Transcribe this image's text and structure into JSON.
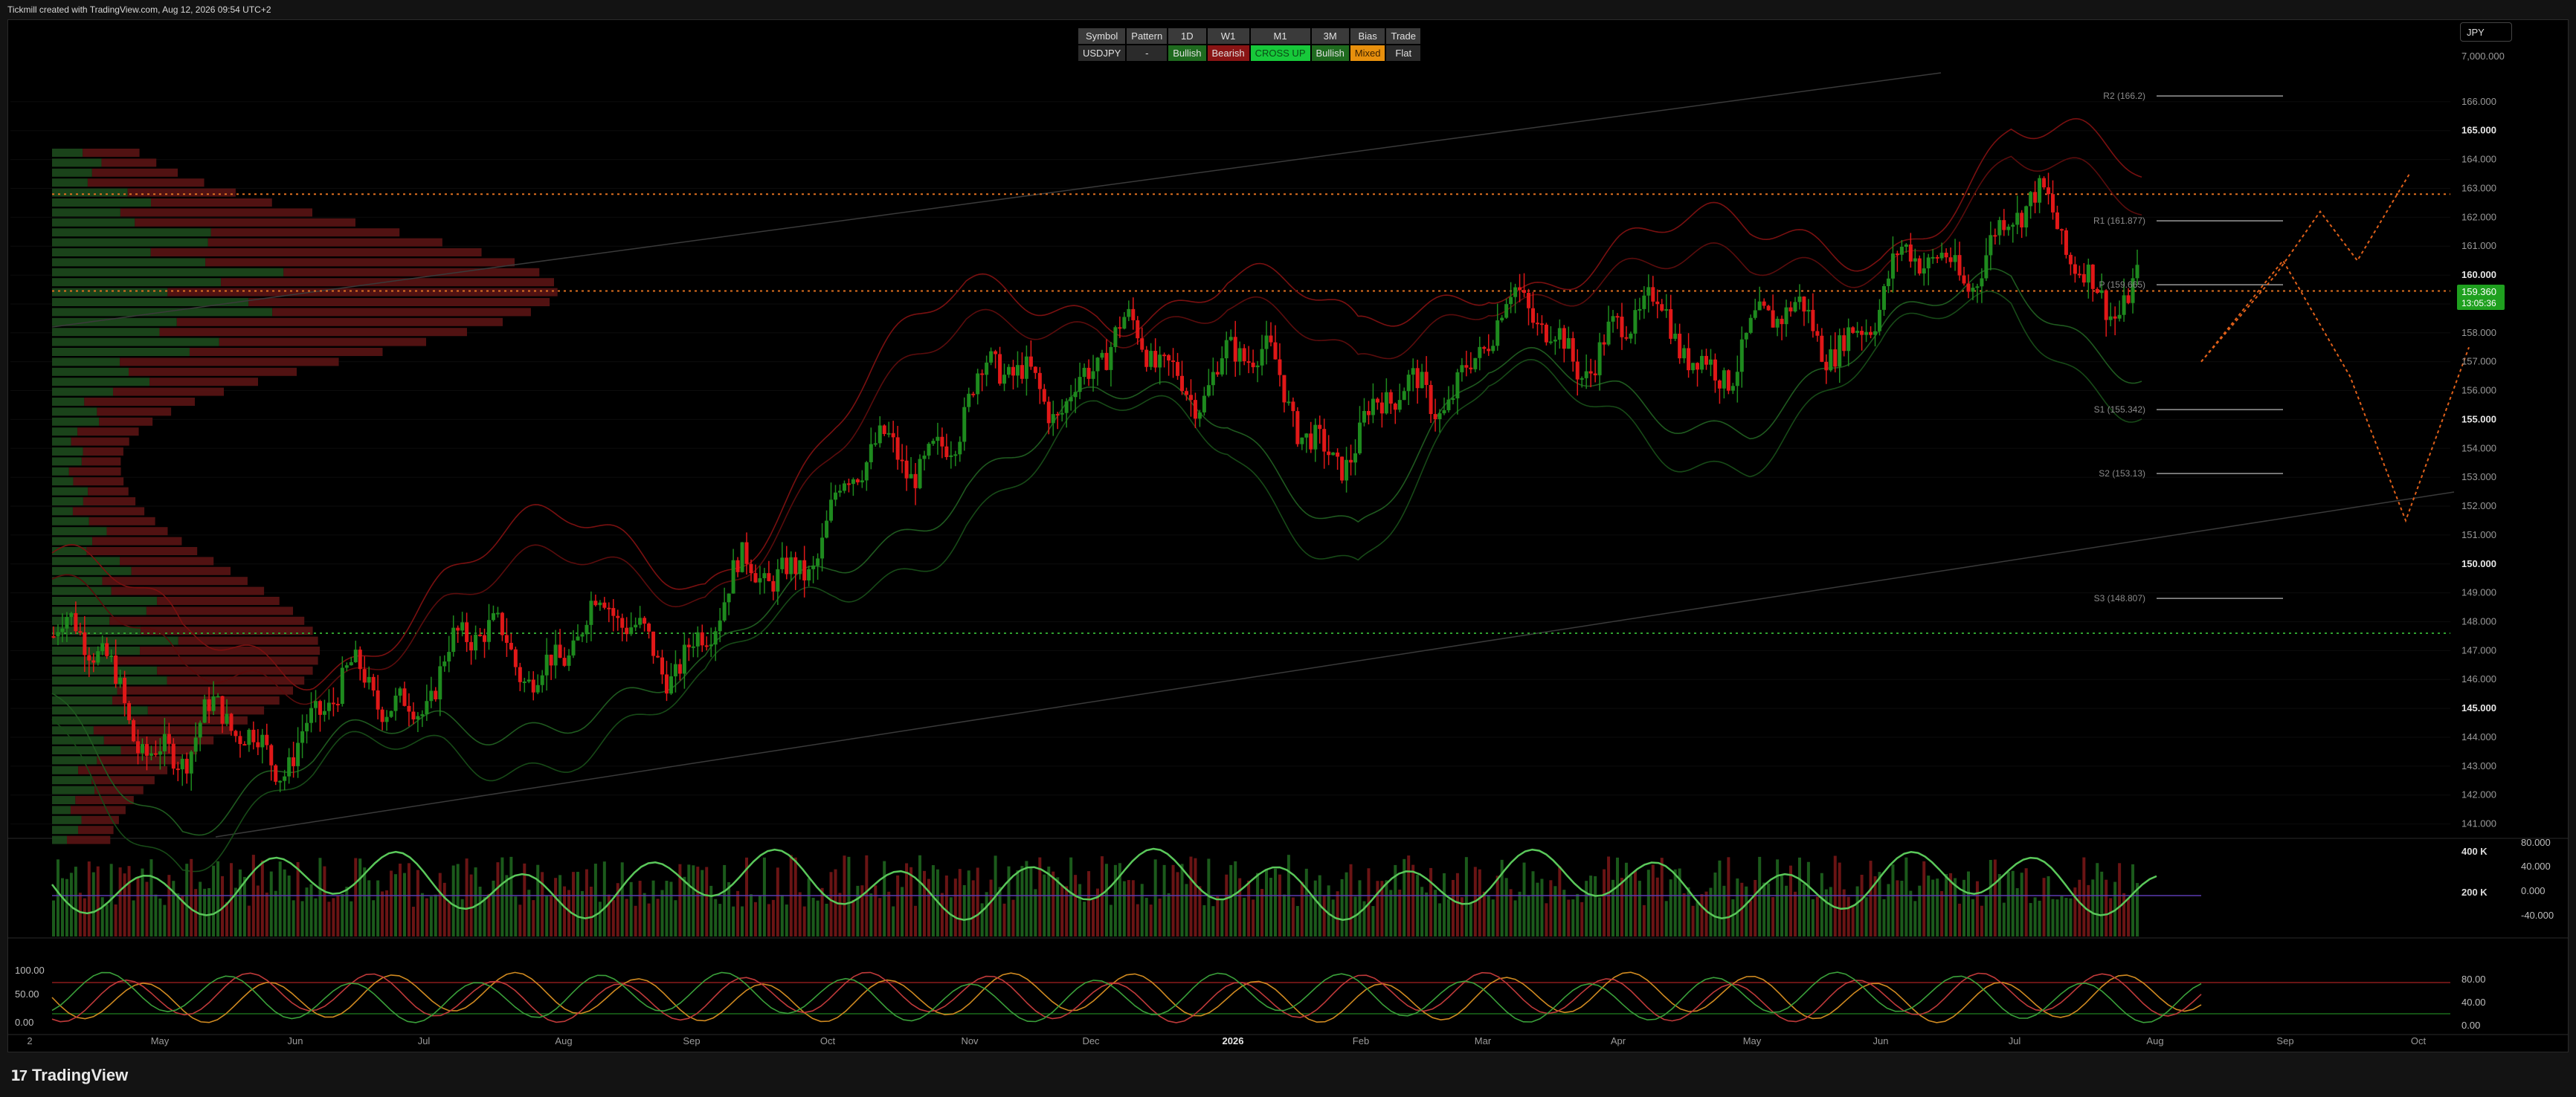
{
  "header": {
    "credit": "Tickmill created with TradingView.com, Aug 12, 2026 09:54 UTC+2"
  },
  "currency_button": "JPY",
  "brand": {
    "name": "TradingView"
  },
  "signal_table": {
    "headers": [
      "Symbol",
      "Pattern",
      "1D",
      "W1",
      "M1",
      "3M",
      "Bias",
      "Trade"
    ],
    "values": [
      {
        "text": "USDJPY",
        "style": "dark"
      },
      {
        "text": "-",
        "style": "dark"
      },
      {
        "text": "Bullish",
        "style": "green"
      },
      {
        "text": "Bearish",
        "style": "red"
      },
      {
        "text": "CROSS UP",
        "style": "lime"
      },
      {
        "text": "Bullish",
        "style": "green"
      },
      {
        "text": "Mixed",
        "style": "orange"
      },
      {
        "text": "Flat",
        "style": "dark"
      }
    ]
  },
  "colors": {
    "up": "#1e8a1e",
    "down": "#e01818",
    "grid": "#111",
    "guide_orange": "#e07020",
    "guide_green": "#2fa02f",
    "price_tag": "#1fa01f"
  },
  "chart_data": {
    "type": "candlestick",
    "symbol": "USDJPY",
    "x_axis_labels": [
      "2",
      "May",
      "Jun",
      "Jul",
      "Aug",
      "Sep",
      "Oct",
      "Nov",
      "Dec",
      "2026",
      "Feb",
      "Mar",
      "Apr",
      "May",
      "Jun",
      "Jul",
      "Aug",
      "Sep",
      "Oct"
    ],
    "y_axis": {
      "ticks": [
        7000000,
        166.0,
        165.0,
        164.0,
        163.0,
        162.0,
        161.0,
        160.0,
        159.0,
        158.0,
        157.0,
        156.0,
        155.0,
        154.0,
        153.0,
        152.0,
        151.0,
        150.0,
        149.0,
        148.0,
        147.0,
        146.0,
        145.0,
        144.0,
        143.0,
        142.0,
        141.0
      ],
      "tick_labels": [
        "7,000.000",
        "166.000",
        "165.000",
        "164.000",
        "163.000",
        "162.000",
        "161.000",
        "160.000",
        "159.000",
        "158.000",
        "157.000",
        "156.000",
        "155.000",
        "154.000",
        "153.000",
        "152.000",
        "151.000",
        "150.000",
        "149.000",
        "148.000",
        "147.000",
        "146.000",
        "145.000",
        "144.000",
        "143.000",
        "142.000",
        "141.000"
      ],
      "bold_labels": [
        "165.000",
        "160.000",
        "155.000",
        "150.000",
        "145.000"
      ],
      "range": [
        140.5,
        167.0
      ]
    },
    "last_price": {
      "value": 159.36,
      "label": "159.360",
      "timer": "13:05:36"
    },
    "pivot_levels": [
      {
        "name": "R2",
        "label": "R2 (166.2)",
        "value": 166.2
      },
      {
        "name": "R1",
        "label": "R1 (161.877)",
        "value": 161.877
      },
      {
        "name": "P",
        "label": "P (159.665)",
        "value": 159.665
      },
      {
        "name": "S1",
        "label": "S1 (155.342)",
        "value": 155.342
      },
      {
        "name": "S2",
        "label": "S2 (153.13)",
        "value": 153.13
      },
      {
        "name": "S3",
        "label": "S3 (148.807)",
        "value": 148.807
      }
    ],
    "horizontal_lines": [
      {
        "value": 162.8,
        "style": "dotted-orange"
      },
      {
        "value": 159.45,
        "style": "dotted-orange"
      },
      {
        "value": 147.6,
        "style": "dotted-green"
      }
    ],
    "price_path": [
      {
        "month": "Apr 2025",
        "price": 147.5
      },
      {
        "month": "May 2025",
        "price": 143.5
      },
      {
        "month": "Jun 2025",
        "price": 144.5
      },
      {
        "month": "Jul 2025",
        "price": 146.5
      },
      {
        "month": "Aug 2025",
        "price": 147.5
      },
      {
        "month": "Sep 2025",
        "price": 147.5
      },
      {
        "month": "Oct 2025",
        "price": 152.0
      },
      {
        "month": "Nov 2025",
        "price": 155.5
      },
      {
        "month": "Dec 2025",
        "price": 157.0
      },
      {
        "month": "Jan 2026",
        "price": 157.0
      },
      {
        "month": "Feb 2026",
        "price": 154.0
      },
      {
        "month": "Mar 2026",
        "price": 158.0
      },
      {
        "month": "Apr 2026",
        "price": 158.0
      },
      {
        "month": "May 2026",
        "price": 157.5
      },
      {
        "month": "Jun 2026",
        "price": 159.0
      },
      {
        "month": "Jul 2026",
        "price": 162.0
      },
      {
        "month": "Aug 2026",
        "price": 159.4
      }
    ],
    "volume_panel": {
      "tick_labels": [
        "400 K",
        "200 K"
      ],
      "osc_labels": [
        "80.000",
        "40.000",
        "0.000",
        "-40.000"
      ]
    },
    "stoch_panel": {
      "left_labels": [
        "100.00",
        "50.00",
        "0.00"
      ],
      "right_labels": [
        "80.00",
        "40.00",
        "0.00"
      ]
    }
  }
}
